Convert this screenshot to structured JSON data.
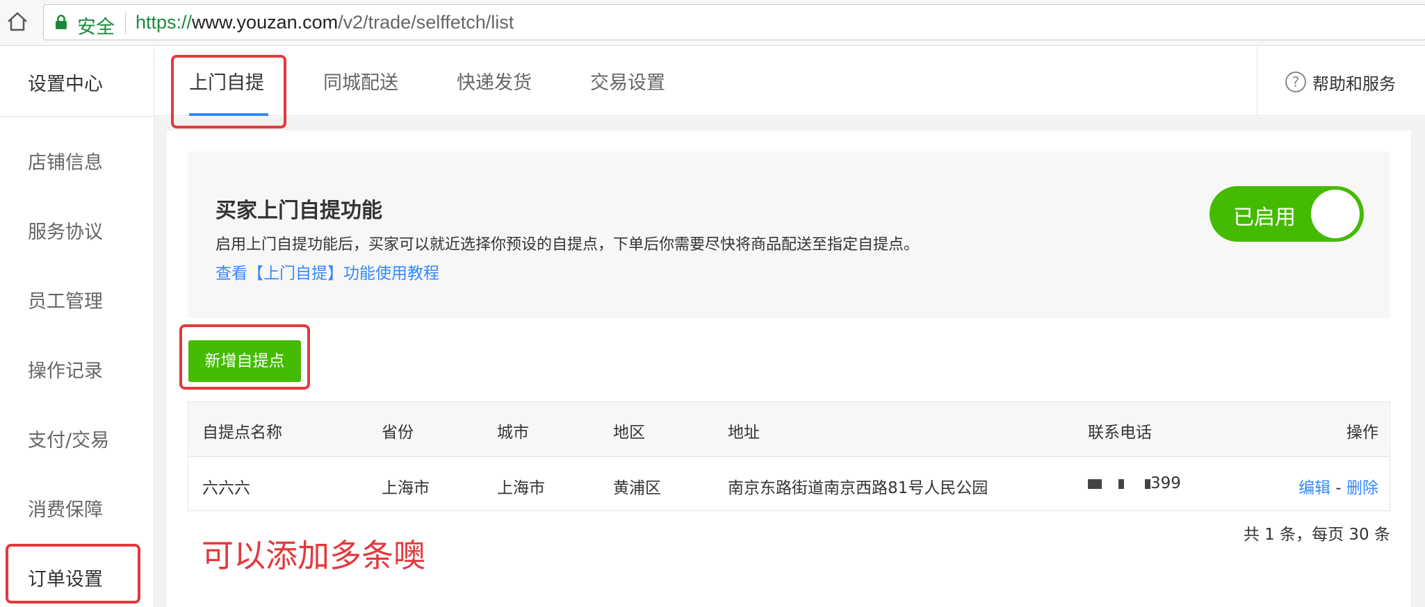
{
  "browser": {
    "secure_label": "安全",
    "url_scheme": "https://",
    "url_host": "www.youzan.com",
    "url_path": "/v2/trade/selffetch/list"
  },
  "sidebar": {
    "title": "设置中心",
    "items": [
      {
        "label": "店铺信息"
      },
      {
        "label": "服务协议"
      },
      {
        "label": "员工管理"
      },
      {
        "label": "操作记录"
      },
      {
        "label": "支付/交易"
      },
      {
        "label": "消费保障"
      },
      {
        "label": "订单设置"
      }
    ]
  },
  "tabs": [
    {
      "label": "上门自提",
      "active": true
    },
    {
      "label": "同城配送"
    },
    {
      "label": "快递发货"
    },
    {
      "label": "交易设置"
    }
  ],
  "help": {
    "icon": "question-circle-icon",
    "label": "帮助和服务"
  },
  "feature": {
    "title": "买家上门自提功能",
    "description": "启用上门自提功能后，买家可以就近选择你预设的自提点，下单后你需要尽快将商品配送至指定自提点。",
    "tutorial_link": "查看【上门自提】功能使用教程",
    "toggle_label": "已启用",
    "enabled": true
  },
  "add_button_label": "新增自提点",
  "table": {
    "columns": [
      "自提点名称",
      "省份",
      "城市",
      "地区",
      "地址",
      "联系电话",
      "操作"
    ],
    "rows": [
      {
        "name": "六六六",
        "province": "上海市",
        "city": "上海市",
        "district": "黄浦区",
        "address": "南京东路街道南京西路81号人民公园",
        "phone_suffix": "399",
        "edit": "编辑",
        "sep": "-",
        "delete": "删除"
      }
    ]
  },
  "pagination": "共 1 条，每页 30 条",
  "annotation_note": "可以添加多条噢",
  "colors": {
    "accent_green": "#44bb00",
    "link_blue": "#3388ff",
    "annotation_red": "#e4393c"
  }
}
